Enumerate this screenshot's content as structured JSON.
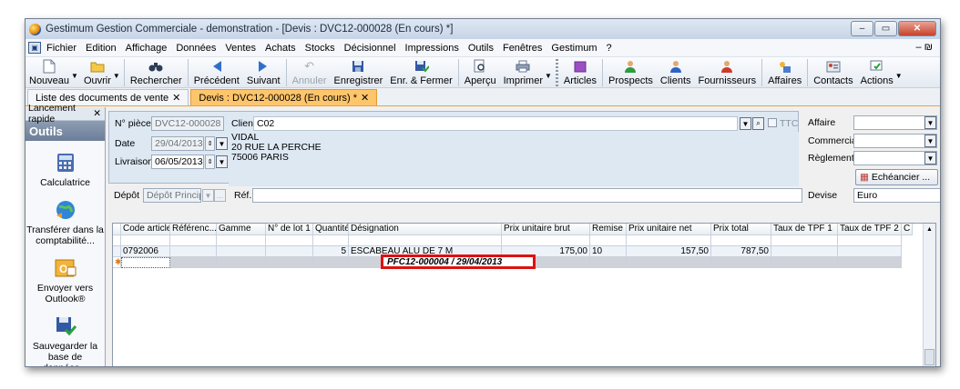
{
  "window": {
    "title": "Gestimum Gestion Commerciale - demonstration - [Devis : DVC12-000028 (En cours) *]",
    "controls": [
      "–",
      "▭",
      "✕"
    ]
  },
  "menu": {
    "items": [
      "Fichier",
      "Edition",
      "Affichage",
      "Données",
      "Ventes",
      "Achats",
      "Stocks",
      "Décisionnel",
      "Impressions",
      "Outils",
      "Fenêtres",
      "Gestimum",
      "?"
    ],
    "right": "– ₪"
  },
  "toolbar": {
    "buttons": [
      {
        "label": "Nouveau",
        "icon": "new-document-icon"
      },
      {
        "label": "Ouvrir",
        "icon": "open-folder-icon"
      },
      {
        "label": "Rechercher",
        "icon": "binoculars-icon"
      },
      {
        "label": "Précédent",
        "icon": "arrow-left-icon"
      },
      {
        "label": "Suivant",
        "icon": "arrow-right-icon"
      },
      {
        "label": "Annuler",
        "icon": "undo-icon"
      },
      {
        "label": "Enregistrer",
        "icon": "save-icon"
      },
      {
        "label": "Enr. & Fermer",
        "icon": "save-close-icon"
      },
      {
        "label": "Aperçu",
        "icon": "preview-icon"
      },
      {
        "label": "Imprimer",
        "icon": "printer-icon"
      },
      {
        "label": "Articles",
        "icon": "box-icon"
      },
      {
        "label": "Prospects",
        "icon": "person-icon"
      },
      {
        "label": "Clients",
        "icon": "person-icon"
      },
      {
        "label": "Fournisseurs",
        "icon": "person-icon"
      },
      {
        "label": "Affaires",
        "icon": "business-icon"
      },
      {
        "label": "Contacts",
        "icon": "contact-card-icon"
      },
      {
        "label": "Actions",
        "icon": "actions-icon"
      }
    ]
  },
  "tabs": [
    {
      "label": "Liste des documents de vente",
      "close": "✕"
    },
    {
      "label": "Devis : DVC12-000028 (En cours) *",
      "close": "✕"
    }
  ],
  "left_panel": {
    "header": "Lancement rapide",
    "close": "✕",
    "section": "Outils",
    "tools": [
      {
        "label": "Calculatrice",
        "icon": "calculator-icon"
      },
      {
        "label": "Transférer dans la comptabilité...",
        "icon": "globe-transfer-icon"
      },
      {
        "label": "Envoyer vers Outlook®",
        "icon": "outlook-icon"
      },
      {
        "label": "Sauvegarder la base de données...",
        "icon": "save-database-icon"
      }
    ]
  },
  "form": {
    "piece_label": "N° pièce",
    "piece_value": "DVC12-000028",
    "date_label": "Date",
    "date_value": "29/04/2013",
    "livraison_label": "Livraison",
    "livraison_value": "06/05/2013",
    "client_label": "Client",
    "client_value": "C02",
    "ttc_label": "TTC",
    "address": [
      "VIDAL",
      "20 RUE LA PERCHE",
      "75006 PARIS"
    ],
    "depot_label": "Dépôt",
    "depot_value": "Dépôt Principal",
    "ref_label": "Réf.",
    "ref_value": "",
    "affaire_label": "Affaire",
    "commercial_label": "Commercial",
    "reglement_label": "Règlement",
    "echeancier_label": "Echéancier ...",
    "devise_label": "Devise",
    "devise_value": "Euro"
  },
  "grid": {
    "columns": [
      "Code article",
      "Référenc...",
      "Gamme",
      "N° de lot 1",
      "Quantité",
      "Désignation",
      "Prix unitaire brut",
      "Remise",
      "Prix unitaire net",
      "Prix total",
      "Taux de TPF 1",
      "Taux de TPF 2",
      "C"
    ],
    "row1": {
      "designation": "PFC12-000004 / 29/04/2013"
    },
    "row2": {
      "code": "0792006",
      "quantite": "5",
      "designation": "ESCABEAU ALU DE 7 M",
      "prix_brut": "175,00",
      "remise": "10",
      "prix_net": "157,50",
      "prix_total": "787,50"
    },
    "new_row_marker": "✱"
  }
}
